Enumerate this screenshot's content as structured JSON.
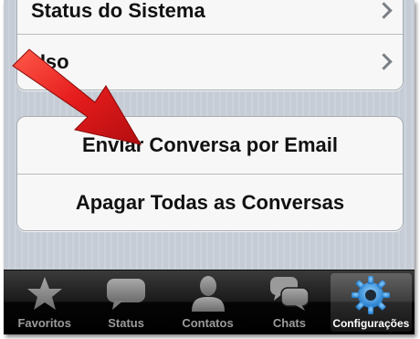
{
  "settings": {
    "top_group": {
      "item_system_status": "Status do Sistema",
      "item_usage": "Uso"
    },
    "bottom_group": {
      "email_chat": "Enviar Conversa por Email",
      "delete_all": "Apagar Todas as Conversas"
    }
  },
  "tabbar": {
    "tabs": [
      {
        "label": "Favoritos",
        "icon": "star-icon"
      },
      {
        "label": "Status",
        "icon": "speech-bubble-icon"
      },
      {
        "label": "Contatos",
        "icon": "person-icon"
      },
      {
        "label": "Chats",
        "icon": "chat-bubbles-icon"
      },
      {
        "label": "Configurações",
        "icon": "gear-icon",
        "active": true
      }
    ]
  },
  "colors": {
    "arrow": "#e0191c",
    "tab_active_icon": "#3ba4e6",
    "tab_inactive_icon": "#8a8a8a"
  }
}
